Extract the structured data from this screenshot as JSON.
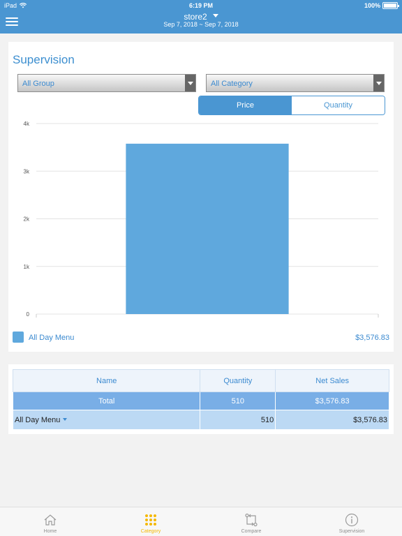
{
  "status_bar": {
    "carrier": "iPad",
    "time": "6:19 PM",
    "battery": "100%"
  },
  "nav": {
    "store": "store2",
    "date_range": "Sep 7, 2018 ~ Sep 7, 2018"
  },
  "page": {
    "title": "Supervision",
    "group_select": "All Group",
    "category_select": "All Category",
    "toggle": {
      "price": "Price",
      "quantity": "Quantity",
      "selected": "Price"
    }
  },
  "chart_data": {
    "type": "bar",
    "categories": [
      "All Day Menu"
    ],
    "values": [
      3576.83
    ],
    "ylim": [
      0,
      4000
    ],
    "yticks": [
      0,
      1000,
      2000,
      3000,
      4000
    ],
    "ytick_labels": [
      "0",
      "1k",
      "2k",
      "3k",
      "4k"
    ],
    "grid": true,
    "bar_color": "#5fa8dd",
    "legend": [
      {
        "name": "All Day Menu",
        "value": "$3,576.83"
      }
    ]
  },
  "table": {
    "headers": [
      "Name",
      "Quantity",
      "Net Sales"
    ],
    "total": {
      "name": "Total",
      "quantity": "510",
      "net_sales": "$3,576.83"
    },
    "rows": [
      {
        "name": "All Day Menu",
        "quantity": "510",
        "net_sales": "$3,576.83"
      }
    ]
  },
  "tabbar": {
    "items": [
      {
        "label": "Home",
        "icon": "home-icon"
      },
      {
        "label": "Category",
        "icon": "grid-icon"
      },
      {
        "label": "Compare",
        "icon": "compare-icon"
      },
      {
        "label": "Supervision",
        "icon": "info-icon"
      }
    ],
    "active": "Category"
  },
  "colors": {
    "primary": "#4a96d2",
    "accent": "#f5b800",
    "bar": "#5fa8dd"
  }
}
